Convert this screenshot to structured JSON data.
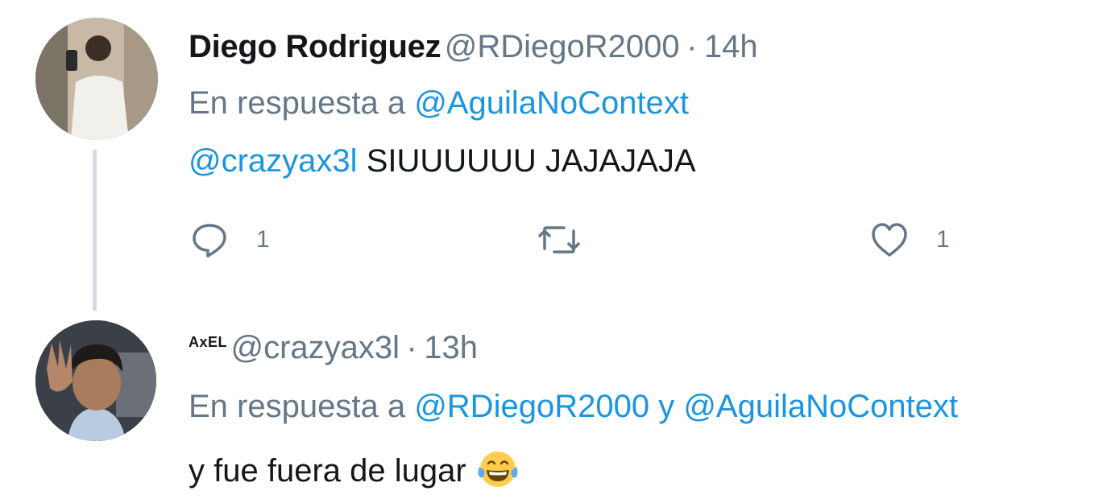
{
  "tweets": [
    {
      "display_name": "Diego Rodriguez",
      "handle": "@RDiegoR2000",
      "separator": "·",
      "time": "14h",
      "reply_prefix": "En respuesta a",
      "reply_to": "@AguilaNoContext",
      "mention": "@crazyax3l",
      "text": "SIUUUUUU JAJAJAJA",
      "actions": {
        "reply_count": "1",
        "retweet_count": "",
        "like_count": "1"
      },
      "avatar_icon": "user-avatar-photo"
    },
    {
      "display_name": "AxEL",
      "handle": "@crazyax3l",
      "separator": "·",
      "time": "13h",
      "reply_prefix": "En respuesta a",
      "reply_to_1": "@RDiegoR2000",
      "reply_joiner": "y",
      "reply_to_2": "@AguilaNoContext",
      "text": "y fue fuera de lugar",
      "emoji": "face-with-tears-of-joy",
      "avatar_icon": "user-avatar-photo"
    }
  ],
  "colors": {
    "link": "#1b95e0",
    "secondary_text": "#657786",
    "primary_text": "#14171a",
    "thread_line": "#d3d9de"
  },
  "icons": [
    "reply-icon",
    "retweet-icon",
    "like-icon"
  ]
}
